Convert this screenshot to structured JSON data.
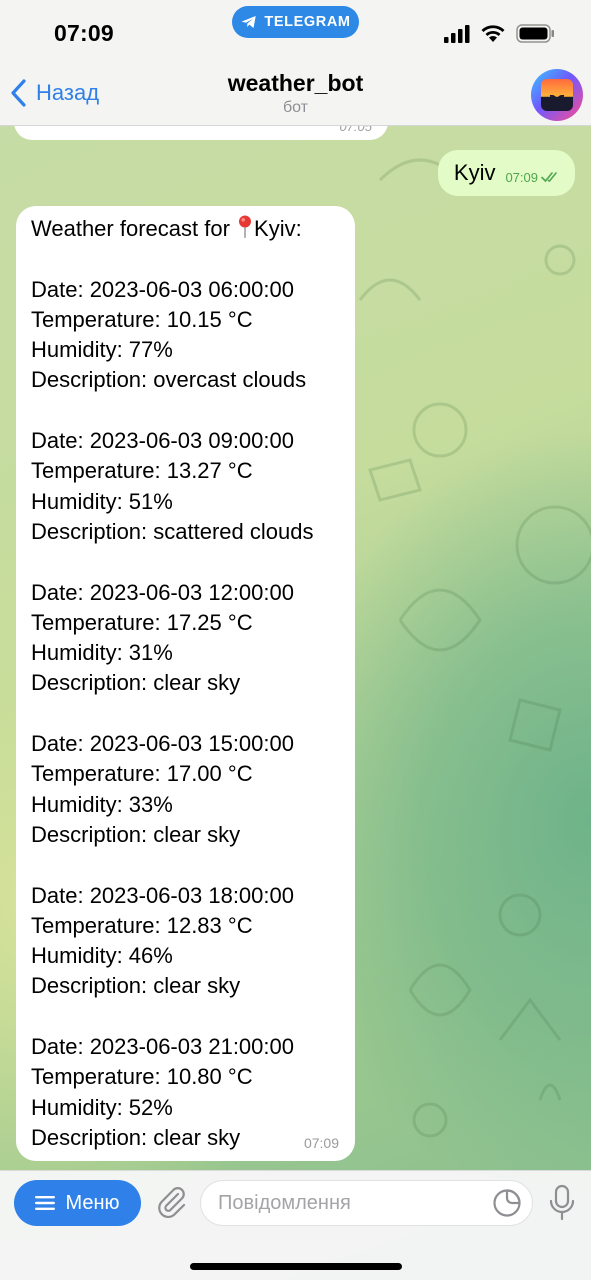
{
  "status_bar": {
    "time": "07:09",
    "app_pill": "TELEGRAM"
  },
  "header": {
    "back_label": "Назад",
    "title": "weather_bot",
    "subtitle": "бот"
  },
  "messages": {
    "clipped_time": "07:05",
    "outgoing": {
      "text": "Kyiv",
      "time": "07:09"
    },
    "incoming": {
      "title_prefix": "Weather forecast for",
      "title_city": "Kyiv:",
      "forecasts": [
        {
          "date": "Date: 2023-06-03 06:00:00",
          "temp": "Temperature: 10.15 °C",
          "humidity": "Humidity: 77%",
          "desc": "Description: overcast clouds"
        },
        {
          "date": "Date: 2023-06-03 09:00:00",
          "temp": "Temperature: 13.27 °C",
          "humidity": "Humidity: 51%",
          "desc": "Description: scattered clouds"
        },
        {
          "date": "Date: 2023-06-03 12:00:00",
          "temp": "Temperature: 17.25 °C",
          "humidity": "Humidity: 31%",
          "desc": "Description: clear sky"
        },
        {
          "date": "Date: 2023-06-03 15:00:00",
          "temp": "Temperature: 17.00 °C",
          "humidity": "Humidity: 33%",
          "desc": "Description: clear sky"
        },
        {
          "date": "Date: 2023-06-03 18:00:00",
          "temp": "Temperature: 12.83 °C",
          "humidity": "Humidity: 46%",
          "desc": "Description: clear sky"
        },
        {
          "date": "Date: 2023-06-03 21:00:00",
          "temp": "Temperature: 10.80 °C",
          "humidity": "Humidity: 52%",
          "desc": "Description: clear sky"
        }
      ],
      "time": "07:09"
    }
  },
  "input_bar": {
    "menu_label": "Меню",
    "placeholder": "Повідомлення"
  },
  "colors": {
    "accent": "#2f80e8",
    "outgoing_bubble": "#e2fbc7",
    "read_check": "#4fa64e",
    "pin": "#e53935"
  },
  "icons": [
    "telegram-plane-icon",
    "signal-icon",
    "wifi-icon",
    "battery-icon",
    "chevron-left-icon",
    "pin-icon",
    "double-check-icon",
    "menu-lines-icon",
    "paperclip-icon",
    "sticker-icon",
    "microphone-icon"
  ]
}
